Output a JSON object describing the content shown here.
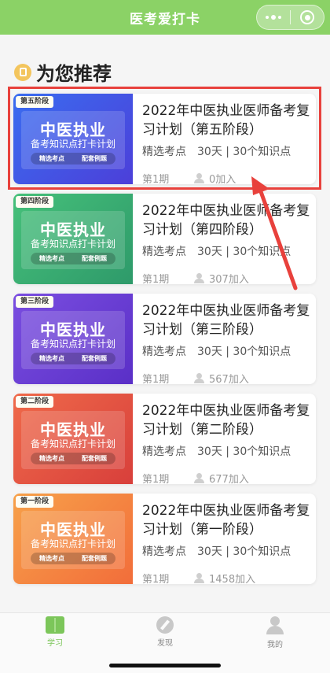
{
  "nav": {
    "title": "医考爱打卡"
  },
  "section": {
    "title": "为您推荐"
  },
  "cover_common": {
    "big": "中医执业",
    "sub": "备考知识点打卡计划",
    "pill_left": "精选考点",
    "pill_right": "配套例题"
  },
  "cards": [
    {
      "stage": "第五阶段",
      "title": "2022年中医执业医师备考复习计划（第五阶段）",
      "meta": "精选考点　30天 | 30个知识点",
      "issue": "第1期",
      "joined": "0加入"
    },
    {
      "stage": "第四阶段",
      "title": "2022年中医执业医师备考复习计划（第四阶段）",
      "meta": "精选考点　30天 | 30个知识点",
      "issue": "第1期",
      "joined": "307加入"
    },
    {
      "stage": "第三阶段",
      "title": "2022年中医执业医师备考复习计划（第三阶段）",
      "meta": "精选考点　30天 | 30个知识点",
      "issue": "第1期",
      "joined": "567加入"
    },
    {
      "stage": "第二阶段",
      "title": "2022年中医执业医师备考复习计划（第二阶段）",
      "meta": "精选考点　30天 | 30个知识点",
      "issue": "第1期",
      "joined": "677加入"
    },
    {
      "stage": "第一阶段",
      "title": "2022年中医执业医师备考复习计划（第一阶段）",
      "meta": "精选考点　30天 | 30个知识点",
      "issue": "第1期",
      "joined": "1458加入"
    }
  ],
  "colors": {
    "nav_bg": "#8bd266",
    "tab_active": "#7cc65a",
    "highlight": "#e8413c",
    "cover_gradients": [
      "#3a6df0",
      "#46c07a",
      "#7a4ee0",
      "#ef6a4a",
      "#f7a14a"
    ]
  },
  "icons": {
    "menu": "more-dots-icon",
    "close": "target-icon",
    "section": "bookmark-icon",
    "tab_learn": "book-icon",
    "tab_discover": "compass-icon",
    "tab_me": "person-icon"
  },
  "tabs": [
    {
      "label": "学习",
      "active": true
    },
    {
      "label": "发现",
      "active": false
    },
    {
      "label": "我的",
      "active": false
    }
  ]
}
